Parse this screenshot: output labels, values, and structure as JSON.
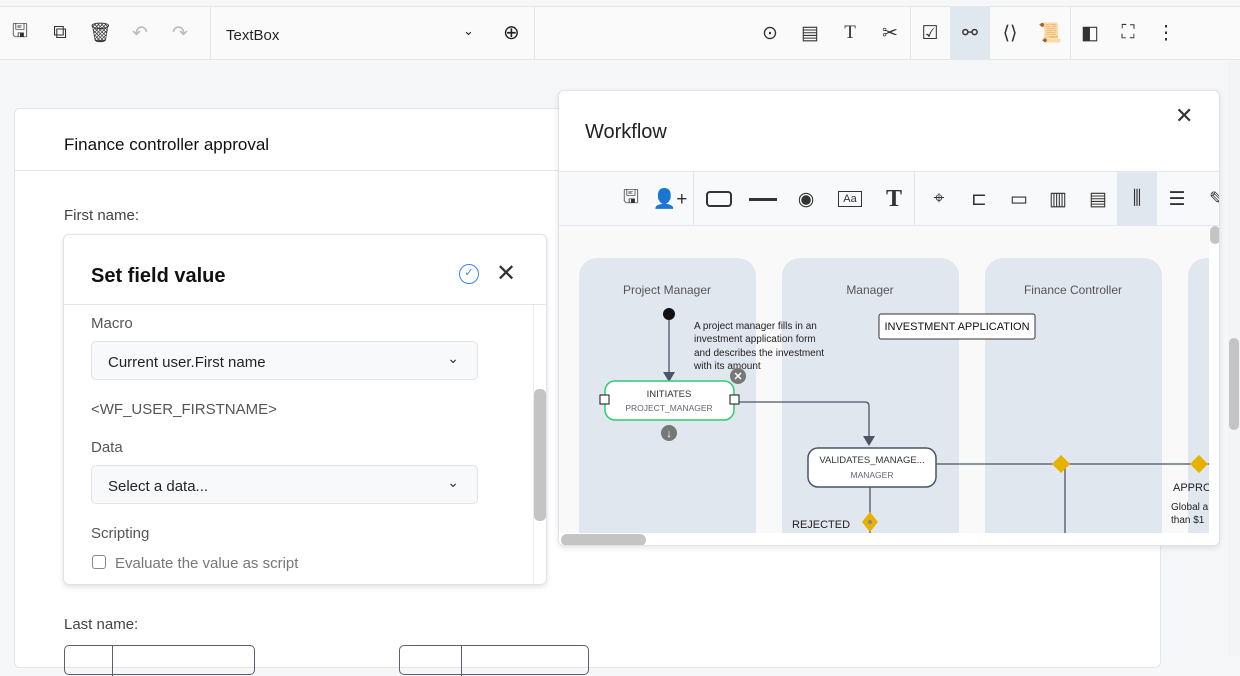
{
  "toolbar": {
    "field_type": "TextBox",
    "left_icons": [
      "save-icon",
      "copy-icon",
      "trash-icon",
      "undo-icon",
      "redo-icon"
    ],
    "right_icons": [
      "preview-icon",
      "form-icon",
      "text-icon",
      "tools-icon",
      "checklist-icon",
      "workflow-icon",
      "code-icon",
      "script-icon",
      "theme-icon",
      "fullscreen-icon",
      "more-icon"
    ]
  },
  "form": {
    "title": "Finance controller approval",
    "first_name_label": "First name:",
    "last_name_label": "Last name:"
  },
  "set_field_value": {
    "title": "Set field value",
    "macro_label": "Macro",
    "macro_value": "Current user.First name",
    "macro_token": "<WF_USER_FIRSTNAME>",
    "data_label": "Data",
    "data_placeholder": "Select a data...",
    "scripting_label": "Scripting",
    "script_checkbox_label": "Evaluate the value as script",
    "script_checked": false,
    "accent": "#3b82f6"
  },
  "workflow": {
    "title": "Workflow",
    "lanes": [
      "Project Manager",
      "Manager",
      "Finance Controller"
    ],
    "annotation": "A project manager fills in an investment application form and describes the investment with its amount",
    "annotation_lines": [
      "A project manager fills in an",
      "investment application form",
      "and describes the investment",
      "with its amount"
    ],
    "label_box": "INVESTMENT APPLICATION",
    "step1": {
      "name": "INITIATES",
      "role": "PROJECT_MANAGER"
    },
    "step2": {
      "name": "VALIDATES_MANAGE...",
      "role": "MANAGER"
    },
    "rejected": "REJECTED",
    "approved_partial": "APPRO",
    "global_partial_1": "Global a",
    "global_partial_2": "than $1",
    "colors": {
      "lane": "#e1e7ef",
      "gateway": "#e8b100",
      "selected": "#2ecc71"
    }
  }
}
